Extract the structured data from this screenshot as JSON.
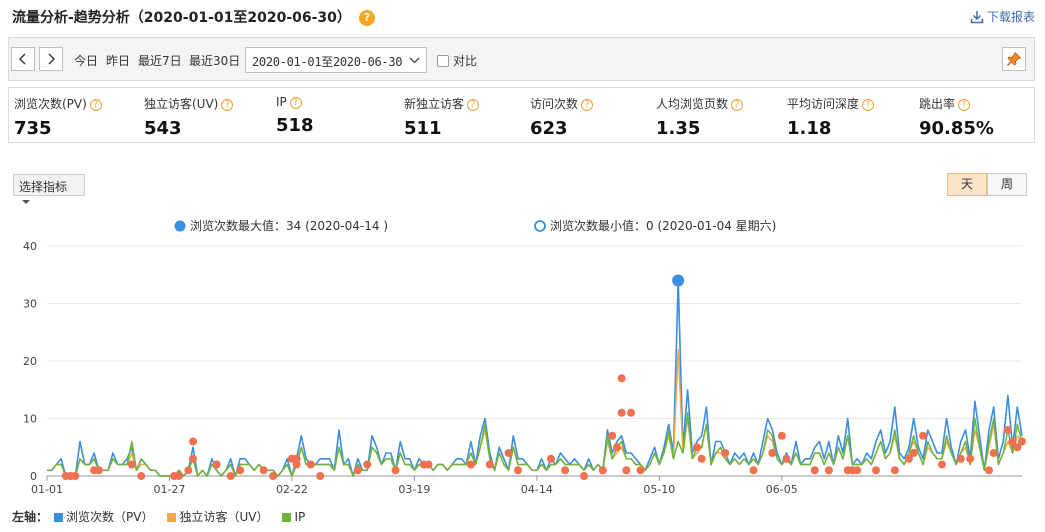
{
  "header": {
    "title": "流量分析-趋势分析（2020-01-01至2020-06-30）",
    "help_glyph": "?",
    "download_label": "下载报表"
  },
  "toolbar": {
    "quick_ranges": [
      "今日",
      "昨日",
      "最近7日",
      "最近30日"
    ],
    "date_range": "2020-01-01至2020-06-30",
    "compare_label": "对比"
  },
  "metrics": [
    {
      "label": "浏览次数(PV)",
      "value": "735"
    },
    {
      "label": "独立访客(UV)",
      "value": "543"
    },
    {
      "label": "IP",
      "value": "518"
    },
    {
      "label": "新独立访客",
      "value": "511"
    },
    {
      "label": "访问次数",
      "value": "623"
    },
    {
      "label": "人均浏览页数",
      "value": "1.35"
    },
    {
      "label": "平均访问深度",
      "value": "1.18"
    },
    {
      "label": "跳出率",
      "value": "90.85%"
    }
  ],
  "controls": {
    "indicator_label": "选择指标",
    "day_label": "天",
    "week_label": "周"
  },
  "chart_data": {
    "type": "line",
    "max_label": "浏览次数最大值：34 (2020-04-14 )",
    "min_label": "浏览次数最小值：0 (2020-01-04 星期六)",
    "ylim": [
      0,
      40
    ],
    "yticks": [
      0,
      10,
      20,
      30,
      40
    ],
    "x_ticks": [
      "01-01",
      "01-27",
      "02-22",
      "03-19",
      "04-14",
      "05-10",
      "06-05"
    ],
    "x_tick_index": [
      0,
      26,
      52,
      78,
      104,
      130,
      156
    ],
    "grid": true,
    "axis_label": "左轴：",
    "colors": {
      "pv": "#3a8ee0",
      "uv": "#f0a850",
      "ip": "#6ab43e",
      "marker": "#f07050"
    },
    "series": [
      {
        "name": "浏览次数（PV）",
        "key": "pv",
        "values": [
          1,
          1,
          2,
          3,
          0,
          0,
          0,
          6,
          2,
          2,
          4,
          1,
          1,
          1,
          4,
          2,
          2,
          3,
          5,
          1,
          3,
          2,
          1,
          1,
          0,
          0,
          0,
          0,
          1,
          0,
          1,
          5,
          0,
          1,
          0,
          3,
          1,
          0,
          1,
          3,
          0,
          3,
          3,
          2,
          1,
          2,
          1,
          1,
          1,
          0,
          1,
          3,
          0,
          3,
          7,
          3,
          2,
          2,
          3,
          3,
          3,
          1,
          8,
          2,
          3,
          0,
          3,
          1,
          1,
          7,
          5,
          2,
          4,
          4,
          1,
          6,
          3,
          3,
          1,
          3,
          2,
          2,
          1,
          2,
          2,
          1,
          2,
          3,
          3,
          2,
          6,
          2,
          7,
          10,
          4,
          1,
          5,
          3,
          1,
          7,
          3,
          3,
          2,
          1,
          1,
          3,
          1,
          3,
          2,
          4,
          3,
          2,
          3,
          2,
          1,
          3,
          1,
          2,
          1,
          8,
          4,
          6,
          7,
          4,
          4,
          3,
          2,
          1,
          3,
          5,
          2,
          5,
          9,
          4,
          34,
          5,
          15,
          4,
          6,
          7,
          12,
          2,
          6,
          6,
          4,
          2,
          4,
          3,
          4,
          2,
          4,
          2,
          6,
          10,
          8,
          4,
          2,
          4,
          2,
          6,
          2,
          3,
          3,
          5,
          6,
          3,
          6,
          2,
          7,
          4,
          10,
          2,
          3,
          2,
          4,
          3,
          6,
          8,
          4,
          6,
          12,
          4,
          3,
          5,
          10,
          5,
          3,
          8,
          6,
          4,
          4,
          10,
          5,
          2,
          6,
          8,
          3,
          13,
          7,
          1,
          8,
          12,
          3,
          6,
          14,
          5,
          12,
          7
        ]
      },
      {
        "name": "独立访客（UV）",
        "key": "uv",
        "values": [
          1,
          1,
          2,
          2,
          0,
          0,
          0,
          3,
          2,
          2,
          3,
          1,
          1,
          1,
          3,
          2,
          2,
          2,
          4,
          1,
          2,
          2,
          1,
          1,
          0,
          0,
          0,
          0,
          1,
          0,
          1,
          3,
          0,
          1,
          0,
          2,
          1,
          0,
          1,
          2,
          0,
          2,
          2,
          2,
          1,
          2,
          1,
          1,
          1,
          0,
          1,
          2,
          0,
          2,
          5,
          2,
          2,
          2,
          2,
          2,
          2,
          1,
          5,
          2,
          2,
          0,
          2,
          1,
          1,
          5,
          4,
          2,
          3,
          3,
          1,
          4,
          2,
          2,
          1,
          2,
          2,
          2,
          1,
          2,
          2,
          1,
          2,
          2,
          2,
          2,
          4,
          2,
          5,
          8,
          3,
          1,
          4,
          2,
          1,
          5,
          2,
          2,
          2,
          1,
          1,
          2,
          1,
          2,
          2,
          3,
          2,
          2,
          2,
          2,
          1,
          2,
          1,
          2,
          1,
          6,
          3,
          4,
          5,
          3,
          3,
          2,
          2,
          1,
          2,
          4,
          2,
          4,
          7,
          3,
          22,
          4,
          10,
          3,
          4,
          5,
          9,
          2,
          4,
          4,
          3,
          2,
          3,
          2,
          3,
          2,
          3,
          2,
          4,
          7,
          6,
          3,
          2,
          3,
          2,
          4,
          2,
          2,
          2,
          4,
          4,
          2,
          4,
          2,
          5,
          3,
          7,
          2,
          2,
          2,
          3,
          2,
          4,
          6,
          3,
          4,
          7,
          3,
          2,
          4,
          6,
          4,
          2,
          5,
          4,
          3,
          3,
          6,
          4,
          2,
          4,
          5,
          2,
          8,
          5,
          1,
          5,
          9,
          2,
          4,
          6,
          4,
          7,
          6
        ]
      },
      {
        "name": "IP",
        "key": "ip",
        "values": [
          1,
          1,
          2,
          2,
          0,
          0,
          0,
          3,
          2,
          2,
          3,
          1,
          1,
          1,
          3,
          2,
          2,
          2,
          6,
          1,
          3,
          2,
          1,
          1,
          0,
          0,
          0,
          0,
          1,
          0,
          1,
          3,
          0,
          1,
          0,
          2,
          1,
          0,
          1,
          2,
          0,
          2,
          2,
          2,
          1,
          2,
          1,
          1,
          1,
          0,
          1,
          2,
          0,
          2,
          5,
          2,
          2,
          2,
          2,
          2,
          2,
          1,
          5,
          2,
          2,
          0,
          2,
          1,
          1,
          5,
          4,
          2,
          3,
          3,
          1,
          4,
          2,
          2,
          1,
          2,
          2,
          2,
          1,
          2,
          2,
          1,
          2,
          2,
          2,
          2,
          4,
          2,
          5,
          9,
          3,
          1,
          4,
          2,
          1,
          5,
          2,
          2,
          2,
          1,
          1,
          2,
          1,
          2,
          2,
          3,
          2,
          2,
          2,
          2,
          1,
          2,
          1,
          2,
          1,
          7,
          3,
          5,
          6,
          3,
          3,
          2,
          2,
          1,
          2,
          4,
          2,
          4,
          8,
          3,
          6,
          4,
          11,
          3,
          5,
          5,
          9,
          2,
          4,
          5,
          3,
          2,
          3,
          2,
          3,
          2,
          3,
          2,
          4,
          8,
          7,
          3,
          2,
          3,
          2,
          4,
          2,
          2,
          2,
          4,
          4,
          2,
          4,
          2,
          5,
          3,
          7,
          2,
          2,
          2,
          3,
          2,
          4,
          6,
          3,
          4,
          8,
          3,
          2,
          4,
          7,
          4,
          2,
          6,
          4,
          3,
          3,
          7,
          4,
          2,
          4,
          6,
          2,
          10,
          5,
          1,
          6,
          10,
          2,
          4,
          8,
          4,
          9,
          6
        ]
      }
    ],
    "markers": [
      [
        4,
        0
      ],
      [
        5,
        0
      ],
      [
        6,
        0
      ],
      [
        10,
        1
      ],
      [
        11,
        1
      ],
      [
        18,
        2
      ],
      [
        20,
        0
      ],
      [
        27,
        0
      ],
      [
        28,
        0
      ],
      [
        30,
        1
      ],
      [
        31,
        6
      ],
      [
        31,
        3
      ],
      [
        36,
        2
      ],
      [
        39,
        0
      ],
      [
        41,
        1
      ],
      [
        46,
        1
      ],
      [
        48,
        0
      ],
      [
        52,
        3
      ],
      [
        53,
        3
      ],
      [
        53,
        2
      ],
      [
        56,
        2
      ],
      [
        58,
        0
      ],
      [
        66,
        1
      ],
      [
        68,
        2
      ],
      [
        74,
        1
      ],
      [
        80,
        2
      ],
      [
        81,
        2
      ],
      [
        90,
        2
      ],
      [
        94,
        2
      ],
      [
        98,
        4
      ],
      [
        100,
        1
      ],
      [
        107,
        3
      ],
      [
        110,
        1
      ],
      [
        114,
        0
      ],
      [
        118,
        1
      ],
      [
        120,
        7
      ],
      [
        121,
        5
      ],
      [
        122,
        17
      ],
      [
        122,
        11
      ],
      [
        123,
        1
      ],
      [
        124,
        11
      ],
      [
        126,
        1
      ],
      [
        134,
        34
      ],
      [
        138,
        5
      ],
      [
        139,
        3
      ],
      [
        144,
        4
      ],
      [
        150,
        1
      ],
      [
        154,
        4
      ],
      [
        156,
        7
      ],
      [
        157,
        3
      ],
      [
        163,
        1
      ],
      [
        166,
        1
      ],
      [
        170,
        1
      ],
      [
        171,
        1
      ],
      [
        172,
        1
      ],
      [
        176,
        1
      ],
      [
        180,
        1
      ],
      [
        183,
        3
      ],
      [
        184,
        4
      ],
      [
        186,
        7
      ],
      [
        190,
        2
      ],
      [
        194,
        3
      ],
      [
        196,
        3
      ],
      [
        200,
        1
      ],
      [
        201,
        4
      ],
      [
        204,
        8
      ],
      [
        205,
        6
      ],
      [
        206,
        5
      ],
      [
        207,
        6
      ]
    ]
  }
}
